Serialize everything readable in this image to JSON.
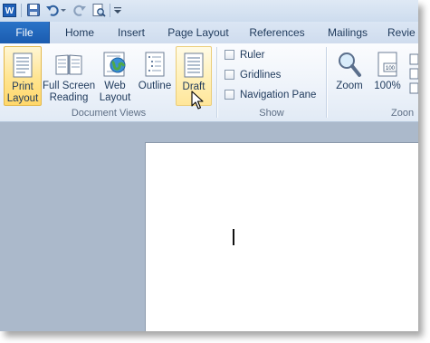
{
  "qat": {
    "app_icon_letter": "W",
    "icons": [
      "word-app-icon",
      "save-icon",
      "undo-icon",
      "redo-icon",
      "print-preview-icon",
      "customize-qat-icon"
    ]
  },
  "tabs": [
    {
      "label": "File",
      "active": false
    },
    {
      "label": "Home"
    },
    {
      "label": "Insert"
    },
    {
      "label": "Page Layout"
    },
    {
      "label": "References"
    },
    {
      "label": "Mailings"
    },
    {
      "label": "Revie"
    }
  ],
  "document_views": {
    "group_label": "Document Views",
    "buttons": [
      {
        "label_line1": "Print",
        "label_line2": "Layout",
        "state": "selected"
      },
      {
        "label_line1": "Full Screen",
        "label_line2": "Reading"
      },
      {
        "label_line1": "Web",
        "label_line2": "Layout"
      },
      {
        "label_line1": "Outline",
        "label_line2": ""
      },
      {
        "label_line1": "Draft",
        "label_line2": "",
        "state": "hover"
      }
    ]
  },
  "show": {
    "group_label": "Show",
    "items": [
      {
        "label": "Ruler",
        "checked": false
      },
      {
        "label": "Gridlines",
        "checked": false
      },
      {
        "label": "Navigation Pane",
        "checked": false
      }
    ]
  },
  "zoom": {
    "group_label": "Zoon",
    "buttons": [
      {
        "label": "Zoom"
      },
      {
        "label": "100%"
      }
    ]
  },
  "colors": {
    "file_tab": "#1b5cb0",
    "workspace": "#abb9cb",
    "highlight": "#ffe48f",
    "text": "#1e395b"
  }
}
